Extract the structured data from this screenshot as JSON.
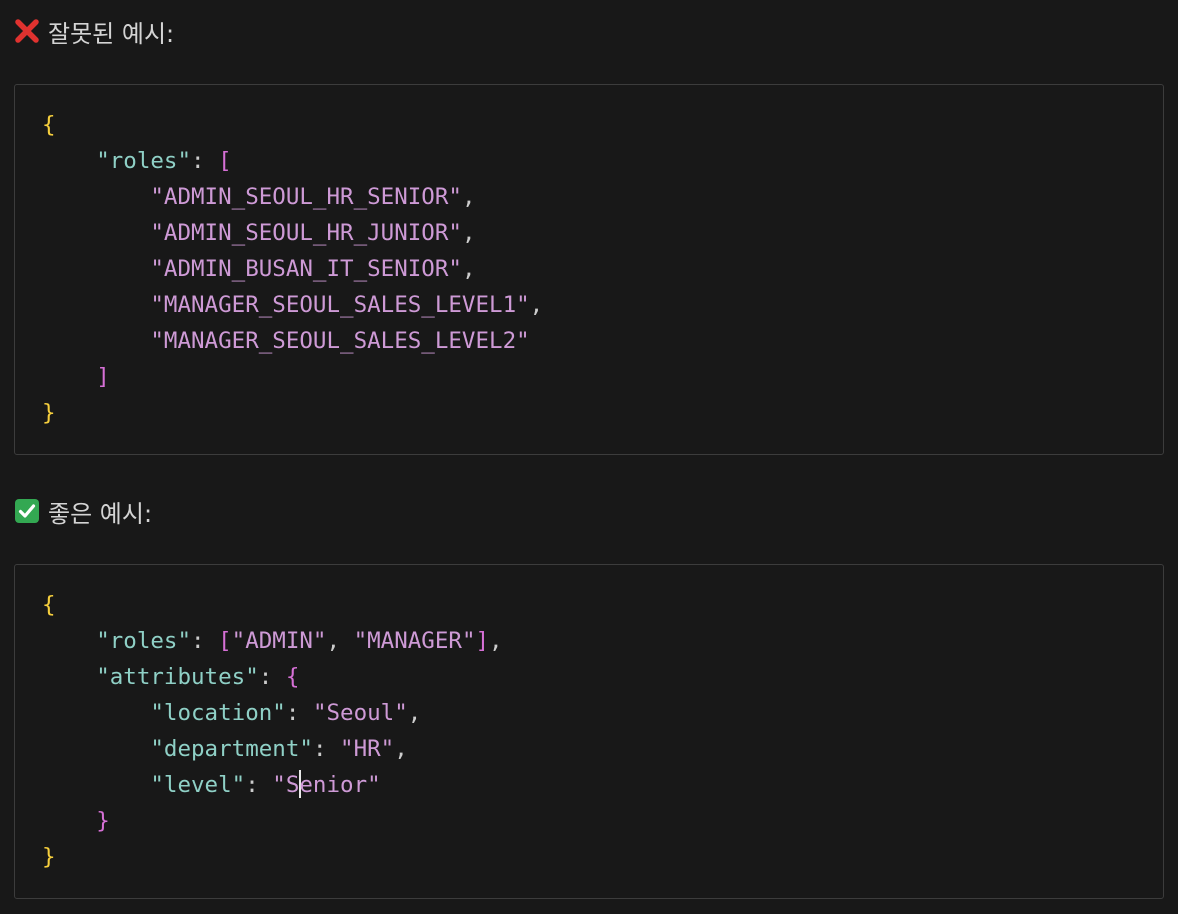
{
  "bad_example": {
    "heading": "잘못된 예시:",
    "icon": "cross-mark-icon",
    "roles_key": "\"roles\"",
    "roles": [
      "\"ADMIN_SEOUL_HR_SENIOR\"",
      "\"ADMIN_SEOUL_HR_JUNIOR\"",
      "\"ADMIN_BUSAN_IT_SENIOR\"",
      "\"MANAGER_SEOUL_SALES_LEVEL1\"",
      "\"MANAGER_SEOUL_SALES_LEVEL2\""
    ]
  },
  "good_example": {
    "heading": "좋은 예시:",
    "icon": "check-mark-icon",
    "roles_key": "\"roles\"",
    "roles": [
      "\"ADMIN\"",
      "\"MANAGER\""
    ],
    "attributes_key": "\"attributes\"",
    "attributes": [
      {
        "key": "\"location\"",
        "value": "\"Seoul\""
      },
      {
        "key": "\"department\"",
        "value": "\"HR\""
      },
      {
        "key": "\"level\"",
        "value_before_cursor": "\"S",
        "value_after_cursor": "enior\""
      }
    ]
  },
  "colors": {
    "background": "#181818",
    "border": "#3c3c3c",
    "brace": "#f6cf3d",
    "bracket": "#d670d6",
    "key": "#8fd0c6",
    "string": "#ce9ad6",
    "cross_icon": "#e0322f",
    "check_icon": "#33a852"
  }
}
